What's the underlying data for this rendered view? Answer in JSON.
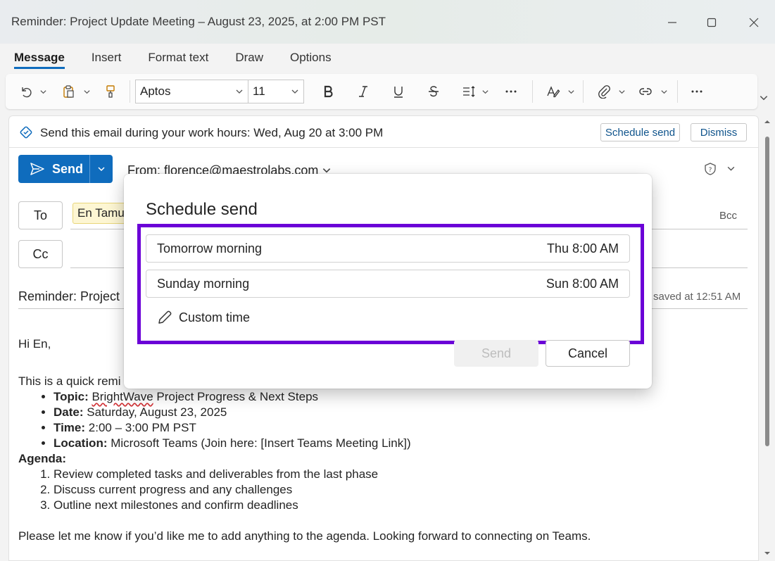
{
  "window": {
    "title": "Reminder: Project Update Meeting – August 23, 2025, at 2:00 PM PST"
  },
  "tabs": [
    {
      "label": "Message",
      "active": true
    },
    {
      "label": "Insert"
    },
    {
      "label": "Format text"
    },
    {
      "label": "Draw"
    },
    {
      "label": "Options"
    }
  ],
  "ribbon": {
    "font_name": "Aptos",
    "font_size": "11",
    "icons": [
      "undo-icon",
      "clipboard-icon",
      "format-painter-icon",
      "bold-icon",
      "italic-icon",
      "underline-icon",
      "strikethrough-icon",
      "paragraph-spacing-icon",
      "more-icon",
      "editor-icon",
      "attach-icon",
      "link-icon"
    ]
  },
  "infobar": {
    "text": "Send this email during your work hours: Wed, Aug 20 at 3:00 PM",
    "schedule_label": "Schedule send",
    "dismiss_label": "Dismiss"
  },
  "compose": {
    "send_label": "Send",
    "from": "From: florence@maestrolabs.com",
    "to_label": "To",
    "cc_label": "Cc",
    "bcc_label": "Bcc",
    "recipient": "En Tamu",
    "subject": "Reminder: Project U",
    "saved": "saved at 12:51 AM"
  },
  "body": {
    "greeting": "Hi En,",
    "intro": "This is a quick remi",
    "details": [
      {
        "label": "Topic:",
        "pre": "",
        "squiggle": "BrightWave",
        "post": " Project Progress & Next Steps"
      },
      {
        "label": "Date:",
        "pre": " Saturday, August 23, 2025",
        "squiggle": "",
        "post": ""
      },
      {
        "label": "Time:",
        "pre": " 2:00 – 3:00 PM PST",
        "squiggle": "",
        "post": ""
      },
      {
        "label": "Location:",
        "pre": " Microsoft Teams (Join here: [Insert Teams Meeting Link])",
        "squiggle": "",
        "post": ""
      }
    ],
    "agenda_label": "Agenda:",
    "agenda": [
      "Review completed tasks and deliverables from the last phase",
      "Discuss current progress and any challenges",
      "Outline next milestones and confirm deadlines"
    ],
    "closing": "Please let me know if you’d like me to add anything to the agenda. Looking forward to connecting on Teams."
  },
  "modal": {
    "title": "Schedule send",
    "options": [
      {
        "label": "Tomorrow morning",
        "time": "Thu 8:00 AM"
      },
      {
        "label": "Sunday morning",
        "time": "Sun 8:00 AM"
      }
    ],
    "custom_label": "Custom time",
    "send_label": "Send",
    "cancel_label": "Cancel"
  },
  "colors": {
    "accent": "#0f6cbd",
    "highlight": "#6b00d7"
  }
}
